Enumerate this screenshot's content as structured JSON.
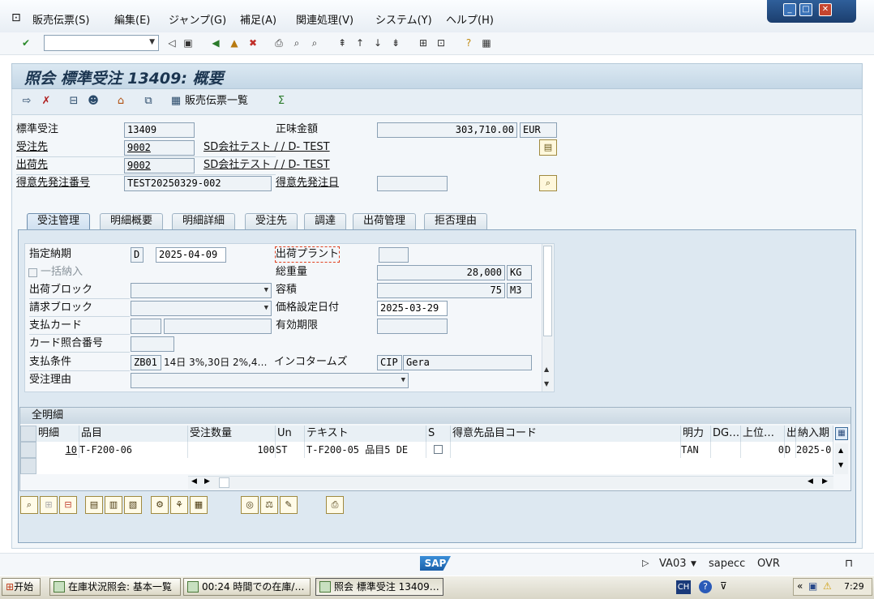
{
  "menu": {
    "items": [
      "販売伝票(S)",
      "編集(E)",
      "ジャンプ(G)",
      "補足(A)",
      "関連処理(V)",
      "システム(Y)",
      "ヘルプ(H)"
    ]
  },
  "title": "照会 標準受注 13409: 概要",
  "app_toolbar": {
    "sales_doc_list": "販売伝票一覧"
  },
  "header": {
    "order_type_label": "標準受注",
    "order_no": "13409",
    "net_value_label": "正味金額",
    "net_value": "303,710.00",
    "currency": "EUR",
    "sold_to_label": "受注先",
    "sold_to": "9002",
    "sold_to_name": "SD会社テスト / / D- TEST",
    "ship_to_label": "出荷先",
    "ship_to": "9002",
    "ship_to_name": "SD会社テスト / / D- TEST",
    "cust_po_label": "得意先発注番号",
    "cust_po": "TEST20250329-002",
    "cust_po_date_label": "得意先発注日",
    "cust_po_date": ""
  },
  "tabs": [
    "受注管理",
    "明細概要",
    "明細詳細",
    "受注先",
    "調達",
    "出荷管理",
    "拒否理由"
  ],
  "sales": {
    "req_deliv_label": "指定納期",
    "req_deliv_type": "D",
    "req_deliv_date": "2025-04-09",
    "complete_deliv_label": "一括納入",
    "delivery_block_label": "出荷ブロック",
    "billing_block_label": "請求ブロック",
    "payment_card_label": "支払カード",
    "card_verif_label": "カード照合番号",
    "payment_terms_label": "支払条件",
    "payment_terms_code": "ZB01",
    "payment_terms_text": "14日 3%,30日 2%,4…",
    "order_reason_label": "受注理由",
    "plant_label": "出荷プラント",
    "plant": "",
    "total_weight_label": "総重量",
    "total_weight": "28,000",
    "weight_unit": "KG",
    "volume_label": "容積",
    "volume": "75",
    "volume_unit": "M3",
    "pricing_date_label": "価格設定日付",
    "pricing_date": "2025-03-29",
    "valid_to_label": "有効期限",
    "incoterms_label": "インコタームズ",
    "incoterms_code": "CIP",
    "incoterms_text": "Gera"
  },
  "items_table": {
    "title": "全明細",
    "columns": [
      "明細",
      "品目",
      "受注数量",
      "Un",
      "テキスト",
      "S",
      "得意先品目コード",
      "明力",
      "DG…",
      "上位…",
      "出",
      "納入期"
    ],
    "rows": [
      {
        "item": "10",
        "material": "T-F200-06",
        "qty": "100",
        "unit": "ST",
        "text": "T-F200-05 品目5 DE",
        "s": "",
        "cust_mat": "",
        "cat": "TAN",
        "dg": "",
        "higher": "0",
        "dd": "D",
        "deliv_date": "2025-0"
      }
    ]
  },
  "status": {
    "tcode": "VA03",
    "system": "sapecc",
    "mode": "OVR"
  },
  "taskbar": {
    "start": "开始",
    "tasks": [
      "在庫状況照会: 基本一覧",
      "00:24 時間での在庫/…",
      "照会 標準受注 13409…"
    ],
    "lang": "CH",
    "time": "7:29"
  },
  "sap_logo": "SAP"
}
